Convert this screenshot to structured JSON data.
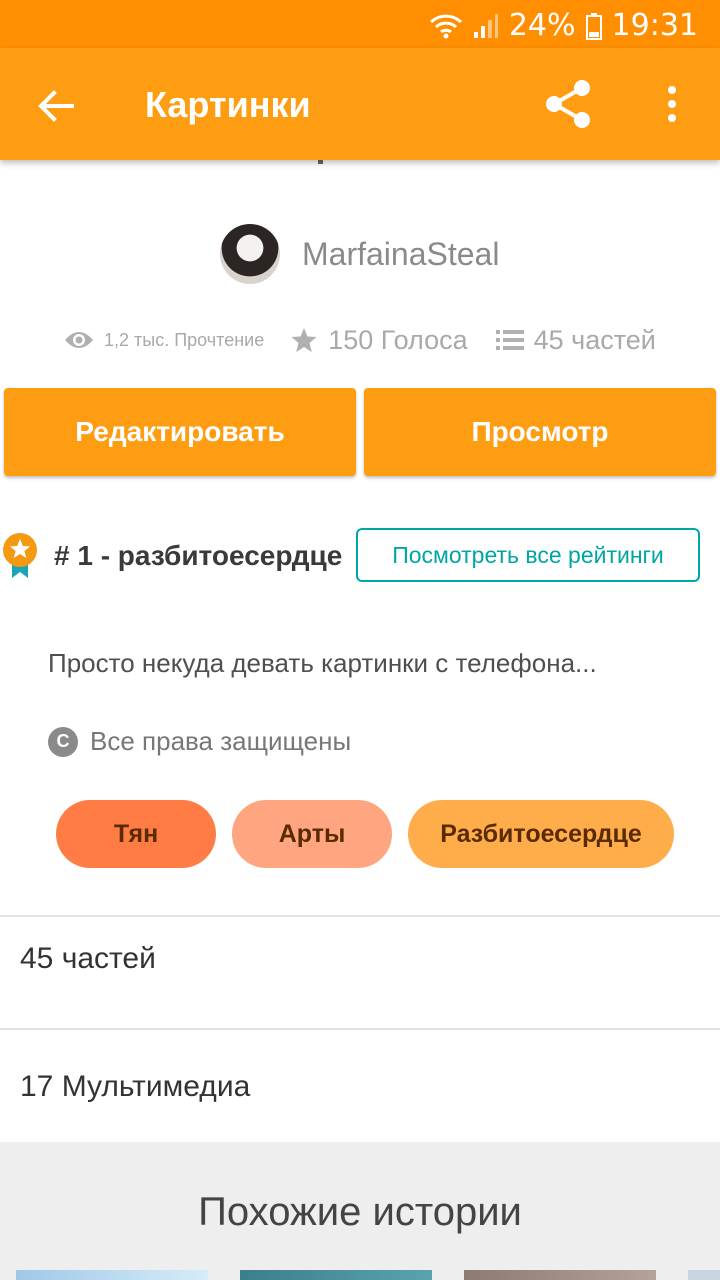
{
  "status_bar": {
    "battery": "24%",
    "time": "19:31"
  },
  "app_bar": {
    "title": "Картинки",
    "icons": [
      "back-arrow-icon",
      "share-icon",
      "more-vert-icon"
    ]
  },
  "author": {
    "name": "MarfainaSteal"
  },
  "stats": {
    "reads": "1,2 тыс. Прочтение",
    "votes": "150 Голоса",
    "parts": "45 частей"
  },
  "actions": {
    "edit_label": "Редактировать",
    "view_label": "Просмотр"
  },
  "ranking": {
    "text": "# 1 - разбитоесердце",
    "button_label": "Посмотреть все рейтинги"
  },
  "description": "Просто некуда девать картинки с телефона...",
  "copyright": {
    "symbol": "C",
    "text": "Все права защищены"
  },
  "tags": [
    {
      "label": "Тян",
      "color": "#ff7d45"
    },
    {
      "label": "Арты",
      "color": "#ffa580"
    },
    {
      "label": "Разбитоесердце",
      "color": "#ffad4a"
    }
  ],
  "sections": {
    "parts": "45 частей",
    "media": "17 Мультимедиа"
  },
  "similar": {
    "title": "Похожие истории"
  },
  "colors": {
    "status_bar": "#ff8f00",
    "app_bar": "#ff9d12",
    "accent_teal": "#00a6a6"
  }
}
